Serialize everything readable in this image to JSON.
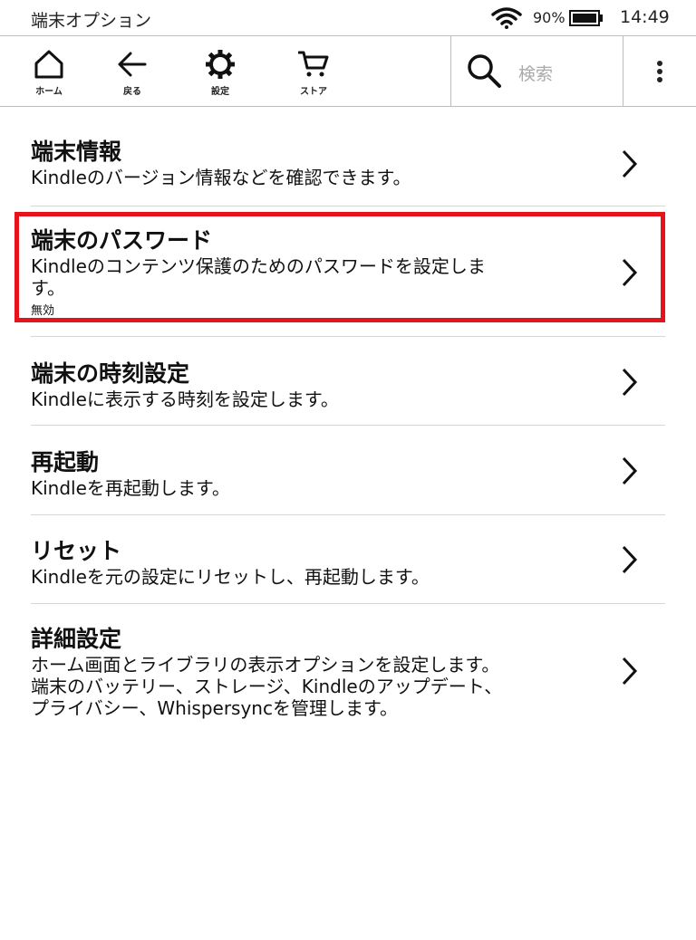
{
  "status_bar": {
    "title": "端末オプション",
    "battery_percent": "90%",
    "time": "14:49"
  },
  "toolbar": {
    "home_label": "ホーム",
    "back_label": "戻る",
    "settings_label": "設定",
    "store_label": "ストア",
    "search_placeholder": "検索"
  },
  "items": [
    {
      "title": "端末情報",
      "description": "Kindleのバージョン情報などを確認できます。"
    },
    {
      "title": "端末のパスワード",
      "description": "Kindleのコンテンツ保護のためのパスワードを設定しま\nす。",
      "status": "無効"
    },
    {
      "title": "端末の時刻設定",
      "description": "Kindleに表示する時刻を設定します。"
    },
    {
      "title": "再起動",
      "description": "Kindleを再起動します。"
    },
    {
      "title": "リセット",
      "description": "Kindleを元の設定にリセットし、再起動します。"
    },
    {
      "title": "詳細設定",
      "description": "ホーム画面とライブラリの表示オプションを設定します。\n端末のバッテリー、ストレージ、Kindleのアップデート、\nプライバシー、Whispersyncを管理します。"
    }
  ],
  "highlight_color": "#e5141c"
}
